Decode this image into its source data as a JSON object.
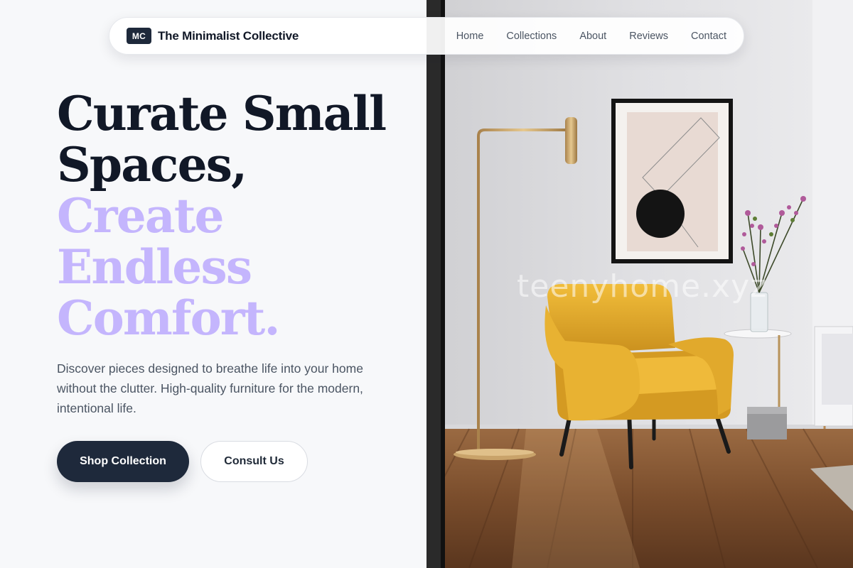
{
  "brand": {
    "logo_text": "MC",
    "name": "The Minimalist Collective"
  },
  "nav": {
    "items": [
      "Home",
      "Collections",
      "About",
      "Reviews",
      "Contact"
    ]
  },
  "hero": {
    "headline_dark": [
      "Curate Small",
      "Spaces,"
    ],
    "headline_light": [
      "Create",
      "Endless",
      "Comfort."
    ],
    "description": "Discover pieces designed to breathe life into your home without the clutter. High-quality furniture for the modern, intentional life.",
    "primary_cta": "Shop Collection",
    "secondary_cta": "Consult Us"
  },
  "image": {
    "watermark": "teenyhome.xyz"
  },
  "colors": {
    "dark_navy": "#1e293b",
    "heading": "#111827",
    "accent_lavender": "#c4b5fd",
    "chair_yellow": "#e3ad2b"
  }
}
